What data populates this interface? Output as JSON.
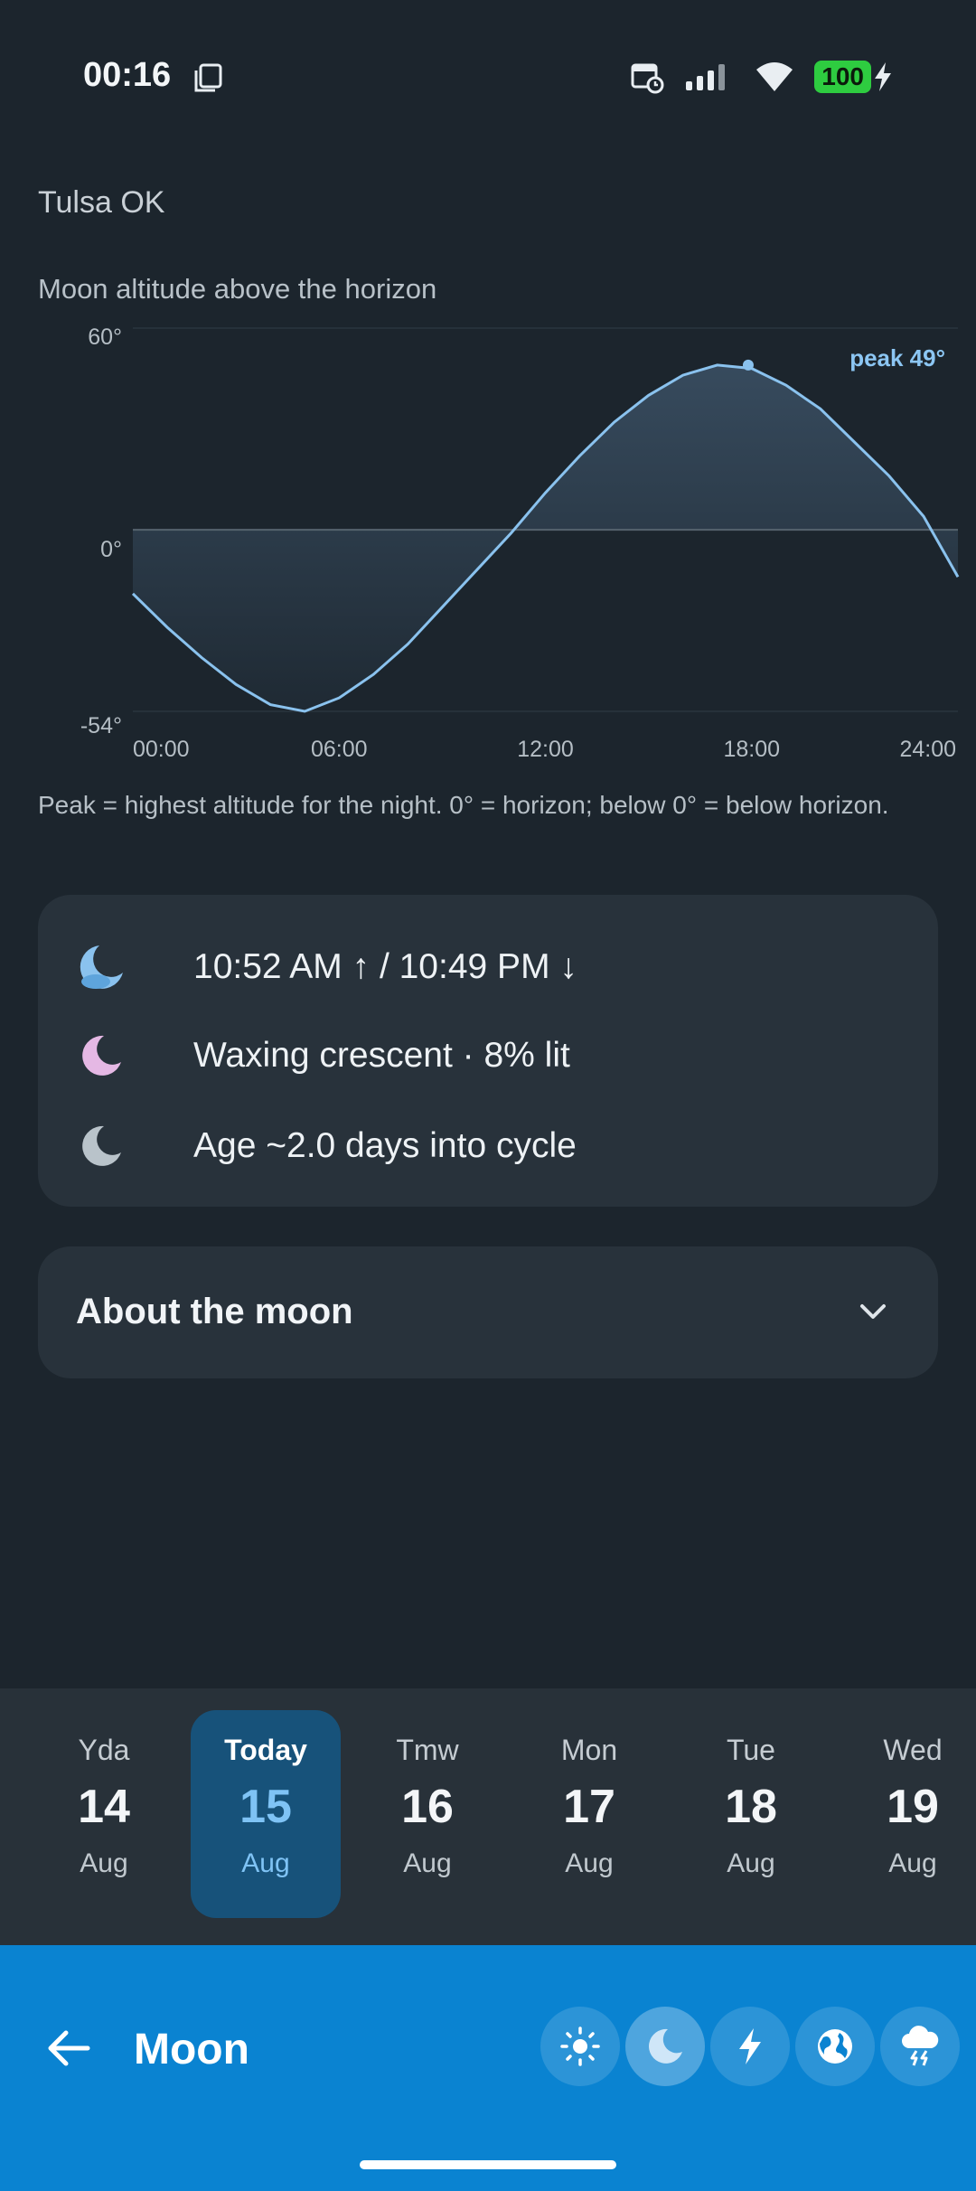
{
  "status_bar": {
    "time": "00:16",
    "battery": "100",
    "icons": [
      "screenshot-icon",
      "calendar-alarm-icon",
      "signal-icon",
      "wifi-icon",
      "battery-icon",
      "charging-icon"
    ]
  },
  "location": "Tulsa OK",
  "chart_caption": "Moon altitude above the horizon",
  "chart_note": "Peak = highest altitude for the night. 0° = horizon; below 0° = below horizon.",
  "chart_data": {
    "type": "area",
    "title": "Moon altitude above the horizon",
    "x_ticks": [
      "00:00",
      "06:00",
      "12:00",
      "18:00",
      "24:00"
    ],
    "y_ticks": [
      "60°",
      "0°",
      "-54°"
    ],
    "ylim": [
      -54,
      60
    ],
    "xlim": [
      0,
      24
    ],
    "peak_label": "peak 49°",
    "peak": {
      "x": 17.9,
      "y": 49
    },
    "x": [
      0,
      1,
      2,
      3,
      4,
      5,
      6,
      7,
      8,
      9,
      10,
      11,
      12,
      13,
      14,
      15,
      16,
      17,
      18,
      19,
      20,
      21,
      22,
      23,
      24
    ],
    "y": [
      -19,
      -29,
      -38,
      -46,
      -52,
      -54,
      -50,
      -43,
      -34,
      -23,
      -12,
      -1,
      11,
      22,
      32,
      40,
      46,
      49,
      48,
      43,
      36,
      26,
      16,
      4,
      -14
    ],
    "colors": {
      "line": "#8ac2ee",
      "fill_top": "#3a4f63",
      "fill_bottom": "#1f2a34"
    }
  },
  "moon_info": {
    "rise_set": "10:52 AM ↑  /  10:49 PM ↓",
    "phase": "Waxing crescent · 8% lit",
    "age": "Age ~2.0 days into cycle"
  },
  "about": {
    "title": "About the moon"
  },
  "days": [
    {
      "label": "Yda",
      "day": "14",
      "month": "Aug",
      "selected": false
    },
    {
      "label": "Today",
      "day": "15",
      "month": "Aug",
      "selected": true
    },
    {
      "label": "Tmw",
      "day": "16",
      "month": "Aug",
      "selected": false
    },
    {
      "label": "Mon",
      "day": "17",
      "month": "Aug",
      "selected": false
    },
    {
      "label": "Tue",
      "day": "18",
      "month": "Aug",
      "selected": false
    },
    {
      "label": "Wed",
      "day": "19",
      "month": "Aug",
      "selected": false
    }
  ],
  "bottom_bar": {
    "title": "Moon",
    "nav": [
      "sun-icon",
      "moon-icon",
      "lightning-icon",
      "globe-icon",
      "storm-icon"
    ],
    "accent": "#0a83d1"
  }
}
